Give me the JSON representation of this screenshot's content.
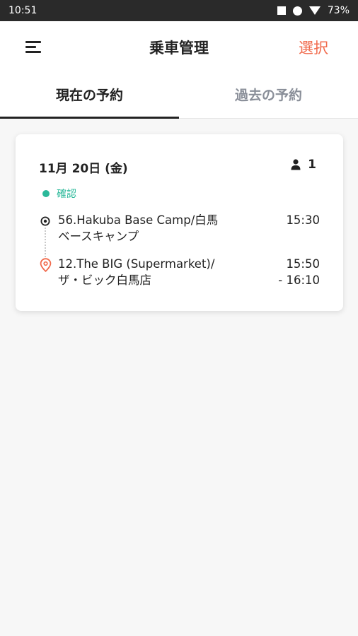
{
  "status_bar": {
    "time": "10:51",
    "battery": "73%"
  },
  "app_bar": {
    "title": "乗車管理",
    "select_label": "選択"
  },
  "tabs": [
    {
      "label": "現在の予約"
    },
    {
      "label": "過去の予約"
    }
  ],
  "booking": {
    "date": "11月 20日 (金)",
    "passengers": "1",
    "status": "確認",
    "origin": {
      "name_line1": "56.Hakuba Base Camp/白馬",
      "name_line2": "ベースキャンプ",
      "time": "15:30"
    },
    "destination": {
      "name_line1": "12.The BIG (Supermarket)/",
      "name_line2": "ザ・ビック白馬店",
      "time_line1": "15:50",
      "time_line2": "- 16:10"
    }
  },
  "colors": {
    "accent": "#f16a4c",
    "status_green": "#2bb99a",
    "status_bar": "#2a2a2a"
  },
  "icons": [
    "menu-icon",
    "person-icon",
    "origin-pin-icon",
    "destination-pin-icon"
  ]
}
